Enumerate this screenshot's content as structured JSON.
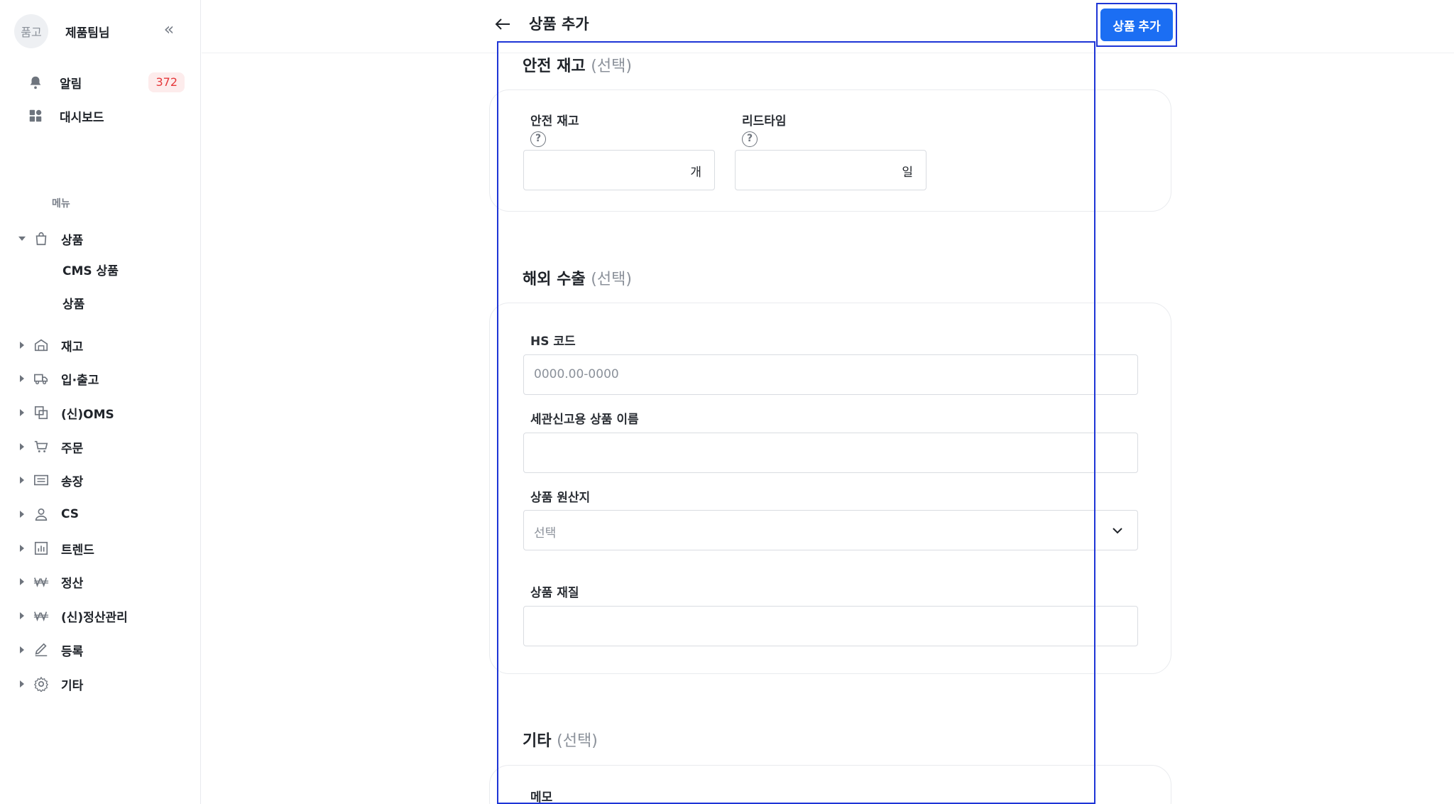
{
  "sidebar": {
    "avatar_text": "품고",
    "profile_name": "제품팀님",
    "collapse_icon": "«",
    "alerts": {
      "label": "알림",
      "count": "372"
    },
    "dashboard": {
      "label": "대시보드"
    },
    "menu_heading": "메뉴",
    "product": {
      "label": "상품",
      "children": [
        "CMS 상품",
        "상품"
      ]
    },
    "items": [
      "재고",
      "입·출고",
      "(신)OMS",
      "주문",
      "송장",
      "CS",
      "트렌드",
      "정산",
      "(신)정산관리",
      "등록",
      "기타"
    ]
  },
  "header": {
    "title": "상품 추가",
    "add_button": "상품 추가"
  },
  "safety_stock": {
    "title": "안전 재고",
    "optional": "(선택)",
    "stock_label": "안전 재고",
    "stock_unit": "개",
    "stock_value": "",
    "leadtime_label": "리드타임",
    "leadtime_unit": "일",
    "leadtime_value": ""
  },
  "export": {
    "title": "해외 수출",
    "optional": "(선택)",
    "hs_label": "HS 코드",
    "hs_placeholder": "0000.00-0000",
    "customs_name_label": "세관신고용 상품 이름",
    "origin_label": "상품 원산지",
    "origin_selected": "선택",
    "material_label": "상품 재질"
  },
  "etc": {
    "title": "기타",
    "optional": "(선택)",
    "memo_label": "메모"
  },
  "colors": {
    "primary": "#1b6ef3",
    "highlight": "#1e35d6",
    "badge_bg": "#fdecec",
    "badge_text": "#e5383b"
  }
}
